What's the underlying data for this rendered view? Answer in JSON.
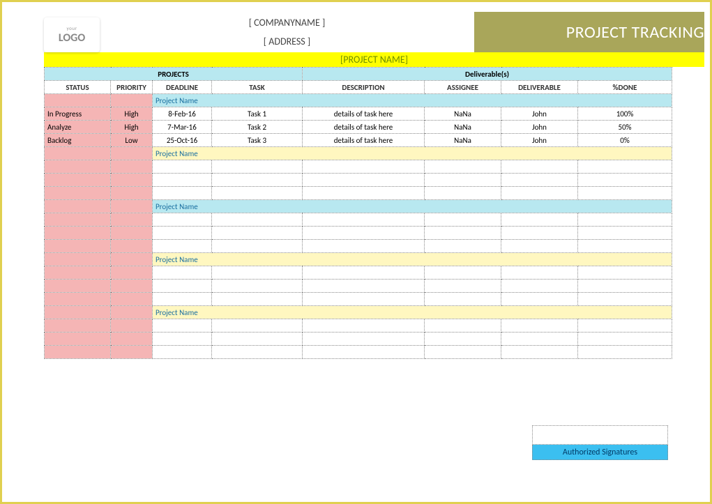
{
  "logo": {
    "top": "your",
    "main": "LOGO"
  },
  "header": {
    "company": "[ COMPANYNAME ]",
    "address": "[ ADDRESS ]",
    "banner": "PROJECT TRACKING"
  },
  "project_name_bar": "[PROJECT NAME]",
  "section_headers": {
    "projects": "PROJECTS",
    "deliverables": "Deliverable(s)"
  },
  "columns": {
    "status": "STATUS",
    "priority": "PRIORITY",
    "deadline": "DEADLINE",
    "task": "TASK",
    "description": "DESCRIPTION",
    "assignee": "ASSIGNEE",
    "deliverable": "DELIVERABLE",
    "done": "%DONE"
  },
  "groups": [
    {
      "label": "Project Name",
      "style": "cyan",
      "rows": [
        {
          "status": "In Progress",
          "priority": "High",
          "deadline": "8-Feb-16",
          "task": "Task 1",
          "description": "details of task here",
          "assignee": "NaNa",
          "deliverable": "John",
          "done": "100%"
        },
        {
          "status": "Analyze",
          "priority": "High",
          "deadline": "7-Mar-16",
          "task": "Task 2",
          "description": "details of task here",
          "assignee": "NaNa",
          "deliverable": "John",
          "done": "50%"
        },
        {
          "status": "Backlog",
          "priority": "Low",
          "deadline": "25-Oct-16",
          "task": "Task 3",
          "description": "details of task here",
          "assignee": "NaNa",
          "deliverable": "John",
          "done": "0%"
        }
      ]
    },
    {
      "label": "Project Name",
      "style": "yellow",
      "rows": [
        {
          "status": "",
          "priority": "",
          "deadline": "",
          "task": "",
          "description": "",
          "assignee": "",
          "deliverable": "",
          "done": ""
        },
        {
          "status": "",
          "priority": "",
          "deadline": "",
          "task": "",
          "description": "",
          "assignee": "",
          "deliverable": "",
          "done": ""
        },
        {
          "status": "",
          "priority": "",
          "deadline": "",
          "task": "",
          "description": "",
          "assignee": "",
          "deliverable": "",
          "done": ""
        }
      ]
    },
    {
      "label": "Project Name",
      "style": "cyan",
      "rows": [
        {
          "status": "",
          "priority": "",
          "deadline": "",
          "task": "",
          "description": "",
          "assignee": "",
          "deliverable": "",
          "done": ""
        },
        {
          "status": "",
          "priority": "",
          "deadline": "",
          "task": "",
          "description": "",
          "assignee": "",
          "deliverable": "",
          "done": ""
        },
        {
          "status": "",
          "priority": "",
          "deadline": "",
          "task": "",
          "description": "",
          "assignee": "",
          "deliverable": "",
          "done": ""
        }
      ]
    },
    {
      "label": "Project Name",
      "style": "yellow",
      "rows": [
        {
          "status": "",
          "priority": "",
          "deadline": "",
          "task": "",
          "description": "",
          "assignee": "",
          "deliverable": "",
          "done": ""
        },
        {
          "status": "",
          "priority": "",
          "deadline": "",
          "task": "",
          "description": "",
          "assignee": "",
          "deliverable": "",
          "done": ""
        },
        {
          "status": "",
          "priority": "",
          "deadline": "",
          "task": "",
          "description": "",
          "assignee": "",
          "deliverable": "",
          "done": ""
        }
      ]
    },
    {
      "label": "Project Name",
      "style": "yellow",
      "rows": [
        {
          "status": "",
          "priority": "",
          "deadline": "",
          "task": "",
          "description": "",
          "assignee": "",
          "deliverable": "",
          "done": ""
        },
        {
          "status": "",
          "priority": "",
          "deadline": "",
          "task": "",
          "description": "",
          "assignee": "",
          "deliverable": "",
          "done": ""
        },
        {
          "status": "",
          "priority": "",
          "deadline": "",
          "task": "",
          "description": "",
          "assignee": "",
          "deliverable": "",
          "done": ""
        }
      ]
    }
  ],
  "signature": {
    "label": "Authorized Signatures"
  }
}
